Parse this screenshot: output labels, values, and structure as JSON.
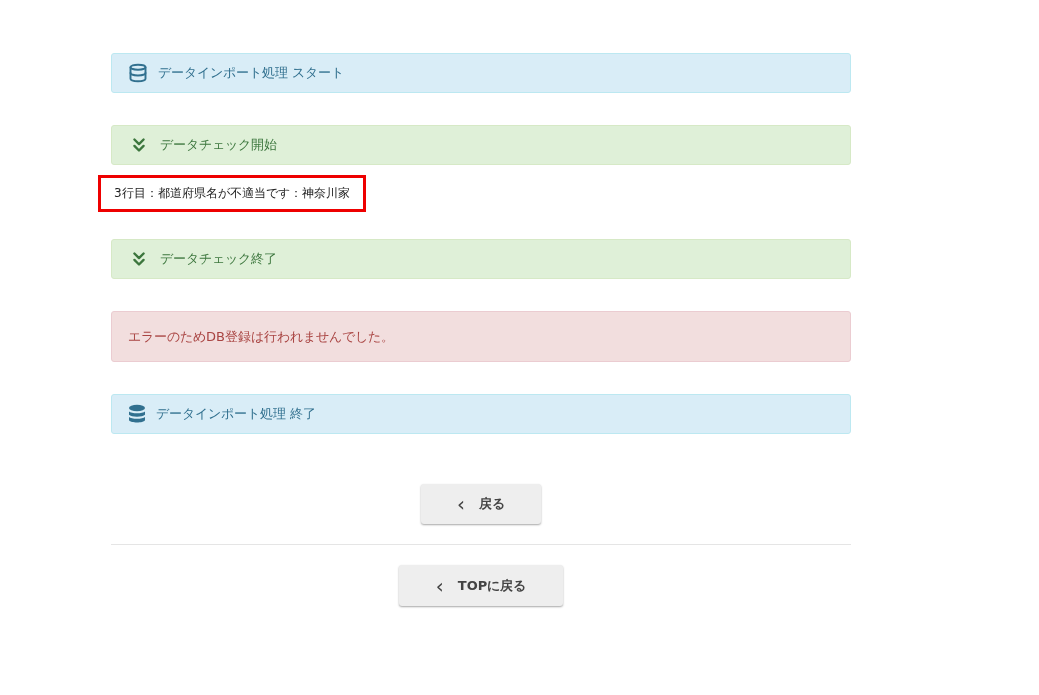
{
  "messages": [
    {
      "kind": "start",
      "text": "データインポート処理 スタート"
    },
    {
      "kind": "check",
      "text": "データチェック開始"
    },
    {
      "kind": "note",
      "highlighted": true,
      "text": "3行目：都道府県名が不適当です：神奈川家"
    },
    {
      "kind": "check",
      "text": "データチェック終了"
    },
    {
      "kind": "error",
      "text": "エラーのためDB登録は行われませんでした。"
    },
    {
      "kind": "end",
      "text": "データインポート処理 終了"
    }
  ],
  "back_button": {
    "icon": "‹",
    "label": "戻る"
  },
  "top_button": {
    "icon": "‹",
    "label": "TOPに戻る"
  }
}
